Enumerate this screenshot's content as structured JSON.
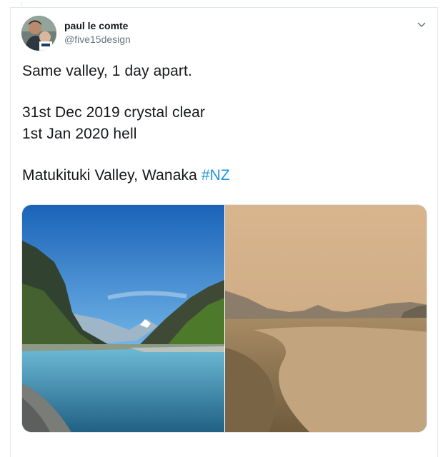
{
  "user": {
    "name": "paul le comte",
    "handle": "@five15design"
  },
  "tweet": {
    "line1": "Same valley, 1 day apart.",
    "line2": "31st Dec 2019 crystal clear",
    "line3": "1st Jan 2020 hell",
    "line4_text": "Matukituki Valley, Wanaka ",
    "hashtag": "#NZ"
  },
  "colors": {
    "text": "#14171a",
    "muted": "#657786",
    "link": "#1b95e0",
    "border": "#e1e8ed"
  },
  "icons": {
    "menu": "chevron-down-icon"
  }
}
